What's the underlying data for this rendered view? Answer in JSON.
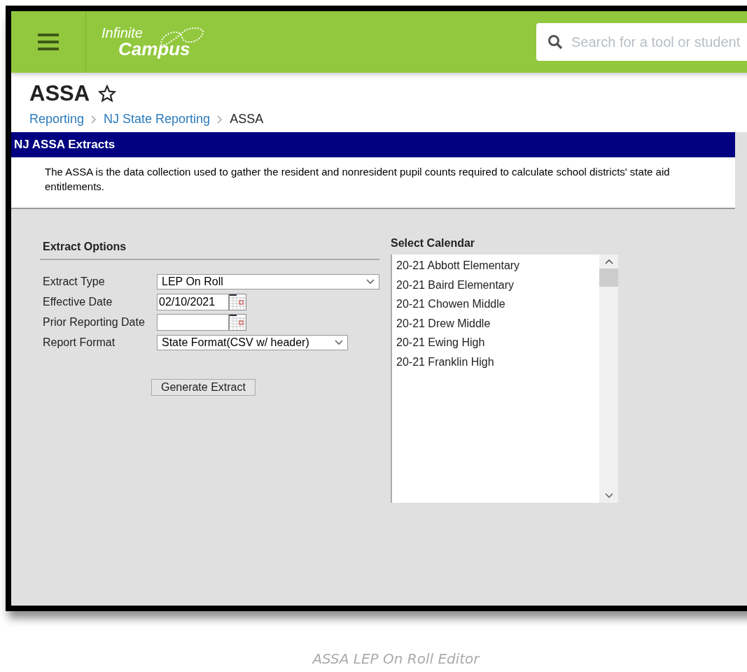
{
  "header": {
    "logo_top": "Infinite",
    "logo_bottom": "Campus",
    "search": {
      "placeholder": "Search for a tool or student"
    }
  },
  "page": {
    "title": "ASSA",
    "favorite": false,
    "breadcrumbs": [
      {
        "label": "Reporting",
        "kind": "link"
      },
      {
        "label": "NJ State Reporting",
        "kind": "link"
      },
      {
        "label": "ASSA",
        "kind": "current"
      }
    ]
  },
  "panel": {
    "title": "NJ ASSA Extracts",
    "description": "The ASSA is the data collection used to gather the resident and nonresident pupil counts required to calculate school districts' state aid entitlements."
  },
  "extract_options": {
    "heading": "Extract Options",
    "fields": [
      {
        "label": "Extract Type",
        "kind": "select",
        "value": "LEP On Roll"
      },
      {
        "label": "Effective Date",
        "kind": "date",
        "value": "02/10/2021"
      },
      {
        "label": "Prior Reporting Date",
        "kind": "date"
      },
      {
        "label": "Report Format",
        "kind": "select-short",
        "value": "State Format(CSV w/ header)"
      }
    ],
    "button": "Generate Extract"
  },
  "calendar": {
    "heading": "Select Calendar",
    "items": [
      {
        "label": "20-21 Abbott Elementary",
        "selected": false
      },
      {
        "label": "20-21 Baird Elementary",
        "selected": false
      },
      {
        "label": "20-21 Chowen Middle",
        "selected": false
      },
      {
        "label": "20-21 Drew Middle",
        "selected": false
      },
      {
        "label": "20-21 Ewing High",
        "selected": false
      },
      {
        "label": "20-21 Franklin High",
        "selected": false
      }
    ]
  },
  "caption": "ASSA LEP On Roll Editor"
}
